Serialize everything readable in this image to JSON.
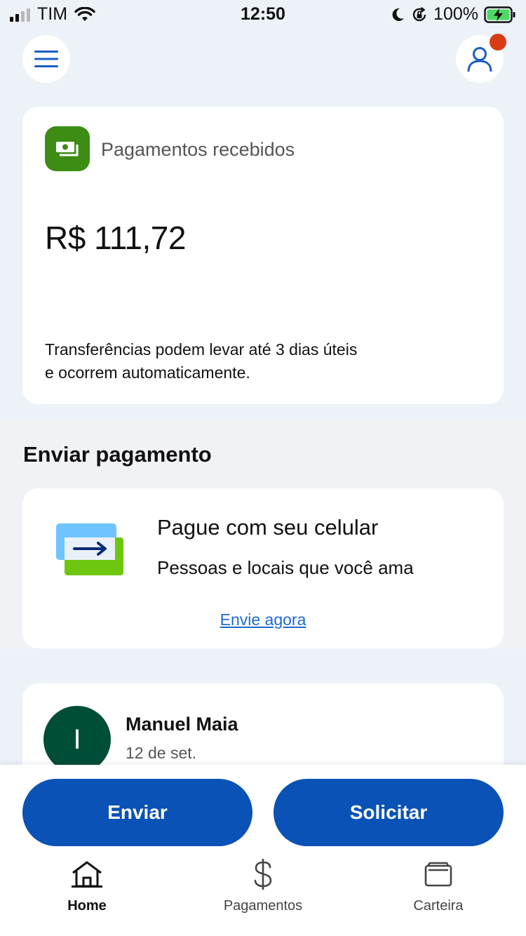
{
  "status_bar": {
    "carrier": "TIM",
    "time": "12:50",
    "battery": "100%",
    "icons": [
      "signal-icon",
      "wifi-icon",
      "moon-icon",
      "rotation-lock-icon",
      "battery-charging-icon"
    ]
  },
  "header": {
    "menu_icon": "hamburger-menu-icon",
    "profile_icon": "user-profile-icon",
    "notification_color": "#d83c14"
  },
  "balance": {
    "icon": "money-icon",
    "label": "Pagamentos recebidos",
    "amount": "R$ 111,72",
    "note_line1": "Transferências podem levar até 3 dias úteis",
    "note_line2": "e ocorrem automaticamente."
  },
  "send_section": {
    "title": "Enviar pagamento",
    "card_title": "Pague com seu celular",
    "card_subtitle": "Pessoas e locais que você ama",
    "link": "Envie agora"
  },
  "activity": {
    "initial": "I",
    "name": "Manuel Maia",
    "date": "12 de set."
  },
  "actions": {
    "send": "Enviar",
    "request": "Solicitar"
  },
  "tabs": [
    {
      "label": "Home",
      "icon": "home-icon",
      "active": true
    },
    {
      "label": "Pagamentos",
      "icon": "dollar-icon",
      "active": false
    },
    {
      "label": "Carteira",
      "icon": "wallet-icon",
      "active": false
    }
  ],
  "colors": {
    "primary": "#0a52b5",
    "background": "#edf1f8",
    "green": "#3d8c14",
    "avatar": "#004d38",
    "link": "#1e6bcf"
  }
}
